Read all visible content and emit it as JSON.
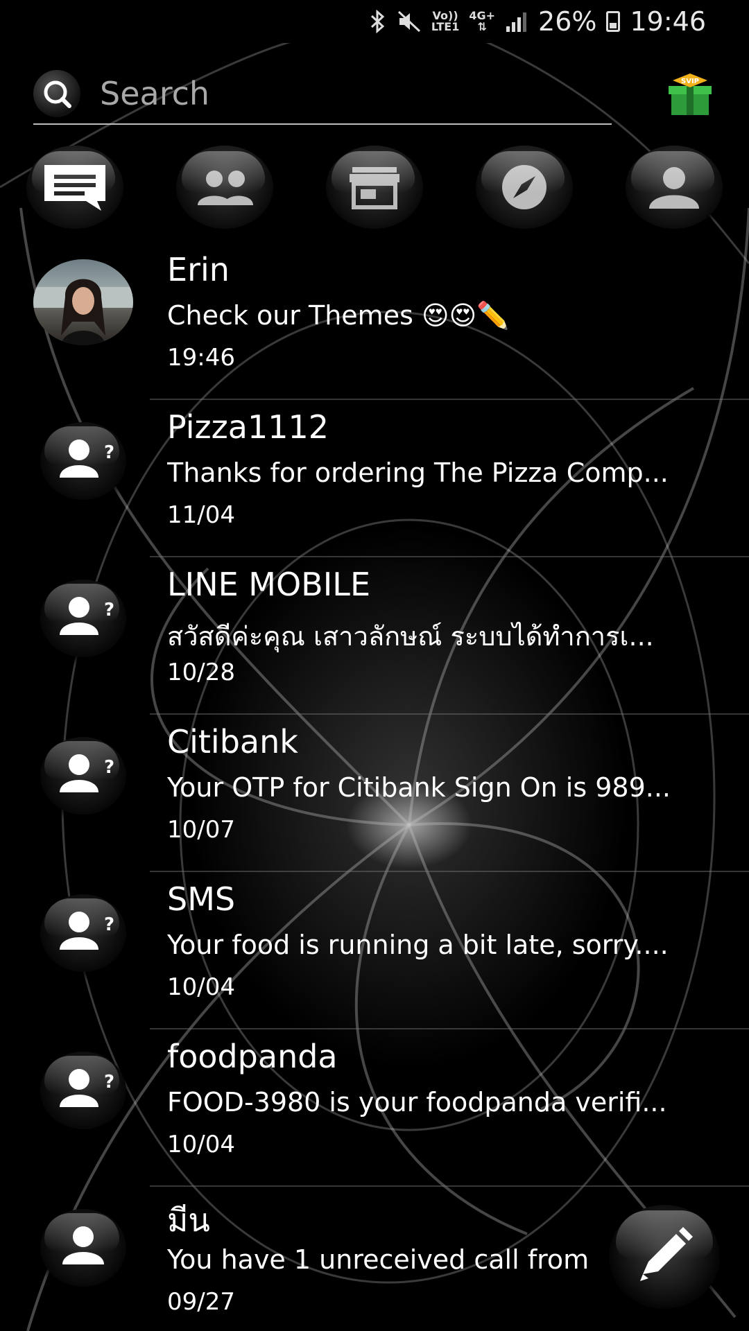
{
  "status_bar": {
    "battery": "26%",
    "time": "19:46",
    "volte_label_top": "Vo))",
    "volte_label_bottom": "LTE1",
    "network": "4G+"
  },
  "search": {
    "placeholder": "Search"
  },
  "svip_badge": "SVIP",
  "tabs": [
    {
      "name": "messages",
      "icon": "chat-icon"
    },
    {
      "name": "contacts",
      "icon": "people-icon"
    },
    {
      "name": "store",
      "icon": "store-icon"
    },
    {
      "name": "discover",
      "icon": "compass-icon"
    },
    {
      "name": "profile",
      "icon": "person-icon"
    }
  ],
  "conversations": [
    {
      "name": "Erin",
      "snippet": "Check our Themes 😍😍✏️",
      "time": "19:46",
      "avatar": "photo"
    },
    {
      "name": "Pizza1112",
      "snippet": "Thanks for ordering The Pizza Comp...",
      "time": "11/04",
      "avatar": "unknown-contact"
    },
    {
      "name": "LINE MOBILE",
      "snippet": "สวัสดีค่ะคุณ เสาวลักษณ์ ระบบได้ทำการเ...",
      "time": "10/28",
      "avatar": "unknown-contact"
    },
    {
      "name": "Citibank",
      "snippet": "Your OTP for Citibank Sign On is 989...",
      "time": "10/07",
      "avatar": "unknown-contact"
    },
    {
      "name": "SMS",
      "snippet": "Your food is running a bit late, sorry....",
      "time": "10/04",
      "avatar": "unknown-contact"
    },
    {
      "name": "foodpanda",
      "snippet": "FOOD-3980 is your foodpanda verifi...",
      "time": "10/04",
      "avatar": "unknown-contact"
    },
    {
      "name": "มีน",
      "snippet": "You have 1 unreceived call from",
      "time": "09/27",
      "avatar": "contact"
    }
  ]
}
